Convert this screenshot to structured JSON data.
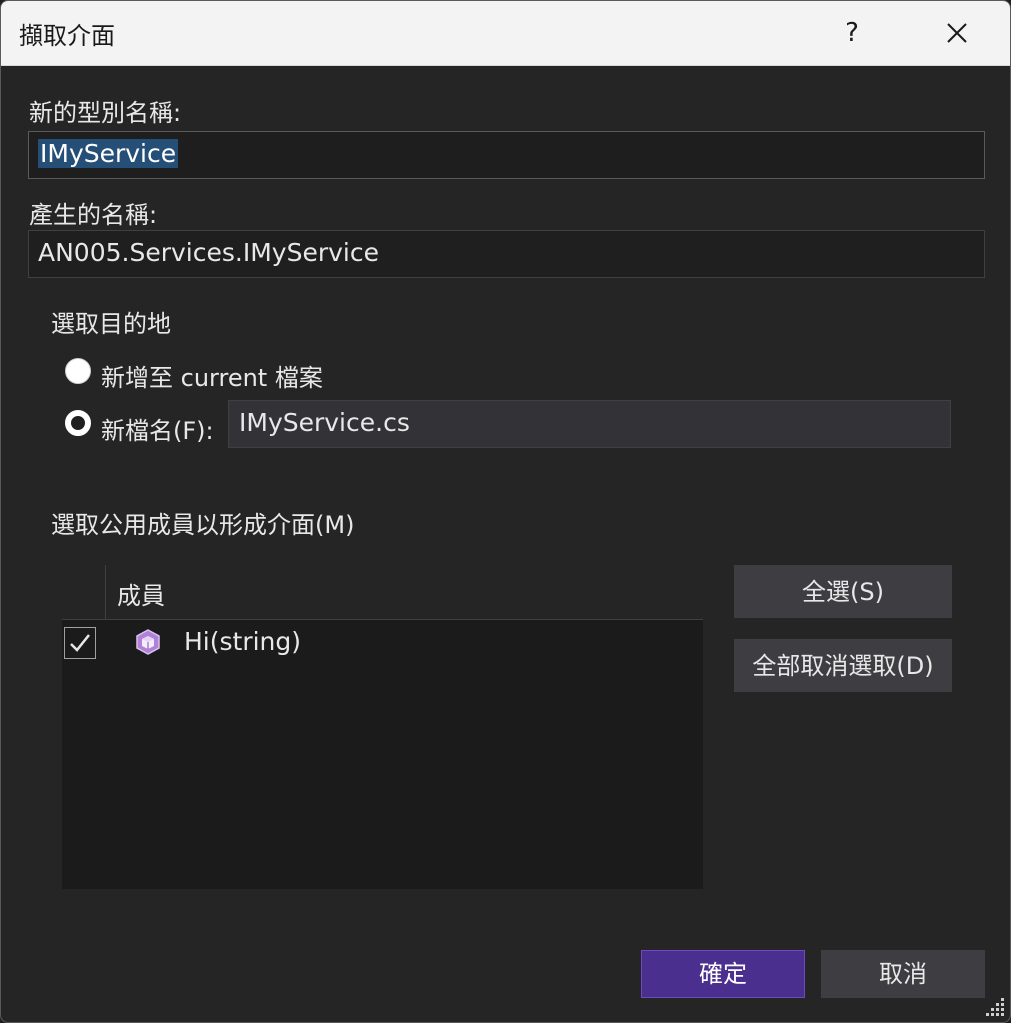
{
  "window": {
    "title": "擷取介面",
    "help": "?"
  },
  "form": {
    "new_type_label": "新的型別名稱:",
    "new_type_value": "IMyService",
    "generated_label": "產生的名稱:",
    "generated_value": "AN005.Services.IMyService",
    "destination_label": "選取目的地",
    "radio_current_label": "新增至 current 檔案",
    "radio_newfile_label": "新檔名(F):",
    "new_file_value": "IMyService.cs",
    "members_label": "選取公用成員以形成介面(M)"
  },
  "members": {
    "column_header": "成員",
    "rows": [
      {
        "name": "Hi(string)",
        "checked": true,
        "icon": "method-cube-icon"
      }
    ]
  },
  "buttons": {
    "select_all": "全選(S)",
    "deselect_all": "全部取消選取(D)",
    "ok": "確定",
    "cancel": "取消"
  },
  "colors": {
    "accent": "#4b2f8f",
    "selection": "#264f78",
    "method_icon": "#b180d7"
  }
}
